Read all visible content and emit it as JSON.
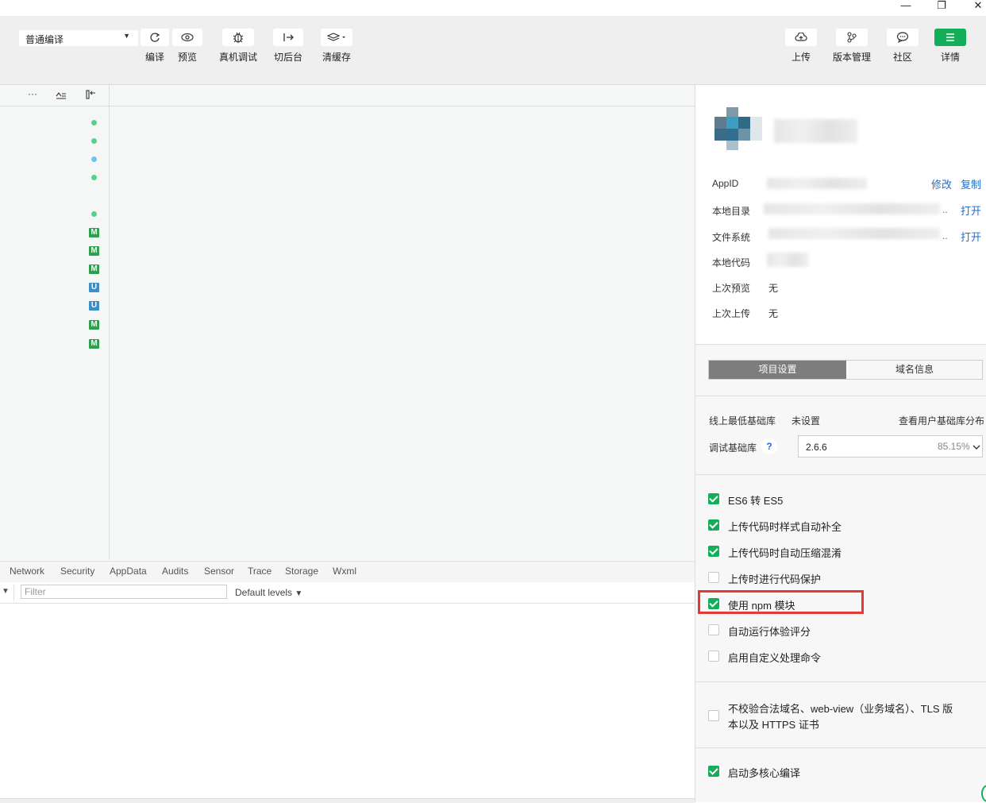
{
  "window": {
    "minimize": "—",
    "restore": "❐",
    "close": "✕"
  },
  "toolbar": {
    "compile_mode": "普通编译",
    "compile_label": "编译",
    "preview_label": "预览",
    "device_debug_label": "真机调试",
    "background_label": "切后台",
    "clear_cache_label": "清缓存",
    "upload_label": "上传",
    "version_label": "版本管理",
    "community_label": "社区",
    "details_label": "详情"
  },
  "left_panel": {
    "dots": [
      "#5bd08d",
      "#5bd08d",
      "#6cc6ef",
      "#5bd08d",
      "#5bd08d"
    ],
    "badges": [
      "M",
      "M",
      "M",
      "U",
      "U",
      "M",
      "M"
    ]
  },
  "console": {
    "tabs": [
      "Network",
      "Security",
      "AppData",
      "Audits",
      "Sensor",
      "Trace",
      "Storage",
      "Wxml"
    ],
    "filter_placeholder": "Filter",
    "levels": "Default levels"
  },
  "project": {
    "appid_label": "AppID",
    "modify_link": "修改",
    "copy_link": "复制",
    "local_dir_label": "本地目录",
    "open_link": "打开",
    "filesystem_label": "文件系统",
    "open_link2": "打开",
    "local_code_label": "本地代码",
    "last_preview_label": "上次预览",
    "last_preview_value": "无",
    "last_upload_label": "上次上传",
    "last_upload_value": "无",
    "ellipsis": ".."
  },
  "tabs": {
    "project_settings": "项目设置",
    "domain_info": "域名信息"
  },
  "settings": {
    "min_lib_label": "线上最低基础库",
    "min_lib_value": "未设置",
    "view_distribution": "查看用户基础库分布",
    "debug_lib_label": "调试基础库",
    "help": "?",
    "lib_version": "2.6.6",
    "lib_percent": "85.15%",
    "options": [
      {
        "label": "ES6 转 ES5",
        "checked": true
      },
      {
        "label": "上传代码时样式自动补全",
        "checked": true
      },
      {
        "label": "上传代码时自动压缩混淆",
        "checked": true
      },
      {
        "label": "上传时进行代码保护",
        "checked": false
      },
      {
        "label": "使用 npm 模块",
        "checked": true
      },
      {
        "label": "自动运行体验评分",
        "checked": false
      },
      {
        "label": "启用自定义处理命令",
        "checked": false
      }
    ],
    "tls_line1": "不校验合法域名、web-view（业务域名）、TLS 版",
    "tls_line2": "本以及 HTTPS 证书",
    "multicore": "启动多核心编译"
  },
  "colors": {
    "accent_green": "#14ad5a",
    "link_blue": "#1a6ed8",
    "highlight_red": "#e53935"
  }
}
